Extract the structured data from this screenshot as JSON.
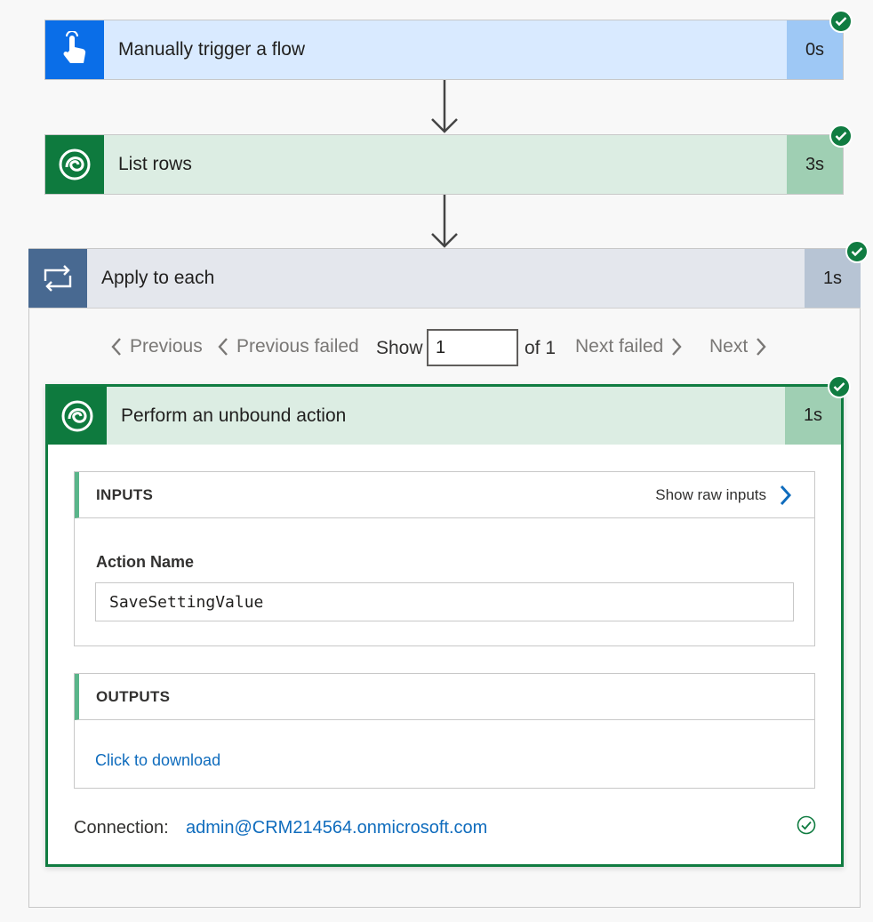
{
  "steps": {
    "trigger": {
      "title": "Manually trigger a flow",
      "duration": "0s",
      "icon": "touch-hand-icon"
    },
    "list_rows": {
      "title": "List rows",
      "duration": "3s",
      "icon": "dataverse-icon"
    },
    "apply_each": {
      "title": "Apply to each",
      "duration": "1s",
      "icon": "loop-icon"
    }
  },
  "pager": {
    "previous": "Previous",
    "previous_failed": "Previous failed",
    "show": "Show",
    "current": "1",
    "of": "of 1",
    "next_failed": "Next failed",
    "next": "Next"
  },
  "action": {
    "title": "Perform an unbound action",
    "duration": "1s",
    "inputs_header": "INPUTS",
    "show_raw_inputs": "Show raw inputs",
    "action_name_label": "Action Name",
    "action_name_value": "SaveSettingValue",
    "outputs_header": "OUTPUTS",
    "download_link": "Click to download",
    "connection_label": "Connection:",
    "connection_value": "admin@CRM214564.onmicrosoft.com"
  },
  "colors": {
    "trigger_bg": "#d9eaff",
    "trigger_icon_bg": "#0a6ee8",
    "dataverse_bg": "#dcede3",
    "dataverse_icon_bg": "#0e7a3e",
    "loop_bg": "#e4e7ed",
    "loop_icon_bg": "#486991",
    "success": "#107c41",
    "link": "#0f6cbd"
  }
}
